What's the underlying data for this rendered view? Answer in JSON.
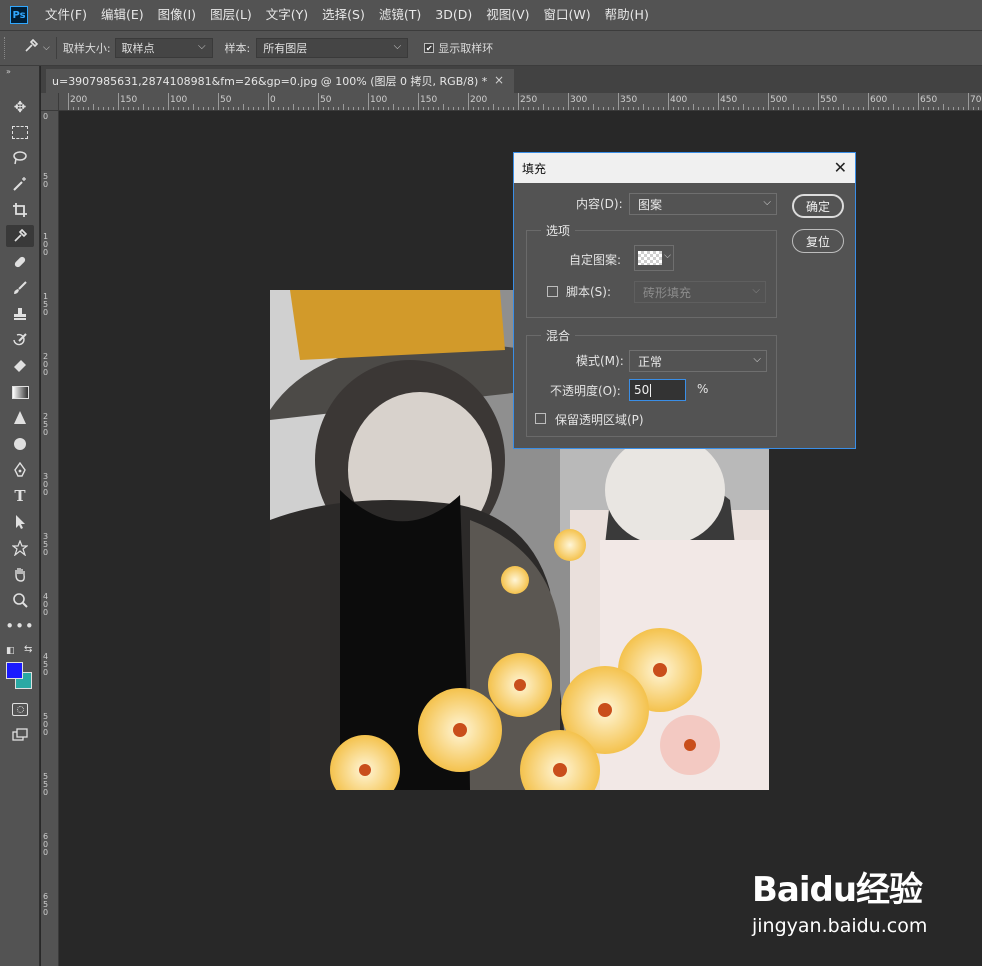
{
  "app": {
    "logo": "Ps"
  },
  "menu": [
    "文件(F)",
    "编辑(E)",
    "图像(I)",
    "图层(L)",
    "文字(Y)",
    "选择(S)",
    "滤镜(T)",
    "3D(D)",
    "视图(V)",
    "窗口(W)",
    "帮助(H)"
  ],
  "options": {
    "sample_size_label": "取样大小:",
    "sample_size_value": "取样点",
    "sample_label": "样本:",
    "sample_value": "所有图层",
    "show_ring_label": "显示取样环",
    "show_ring_checked": true
  },
  "document": {
    "tab_title": "u=3907985631,2874108981&fm=26&gp=0.jpg @ 100% (图层 0 拷贝, RGB/8) *",
    "close_glyph": "×"
  },
  "ruler": {
    "top_labels": [
      "200",
      "150",
      "100",
      "50",
      "0",
      "50",
      "100",
      "150",
      "200",
      "250",
      "300",
      "350",
      "400",
      "450",
      "500",
      "550",
      "600",
      "650",
      "70"
    ],
    "left_labels": [
      "0",
      "50",
      "100",
      "150",
      "200",
      "250",
      "300",
      "350",
      "400",
      "450",
      "500",
      "550",
      "600",
      "650"
    ]
  },
  "colors": {
    "foreground": "#1a1aff",
    "background": "#2aa9a4",
    "accent": "#3a8ee6"
  },
  "dialog": {
    "title": "填充",
    "close_glyph": "✕",
    "content_label": "内容(D):",
    "content_value": "图案",
    "ok_label": "确定",
    "reset_label": "复位",
    "options_group": "选项",
    "custom_pattern_label": "自定图案:",
    "script_label": "脚本(S):",
    "script_checked": false,
    "script_value": "砖形填充",
    "blend_group": "混合",
    "mode_label": "模式(M):",
    "mode_value": "正常",
    "opacity_label": "不透明度(O):",
    "opacity_value": "50",
    "opacity_unit": "%",
    "preserve_label": "保留透明区域(P)",
    "preserve_checked": false
  },
  "watermark": {
    "brand": "Baidu经验",
    "url": "jingyan.baidu.com"
  }
}
